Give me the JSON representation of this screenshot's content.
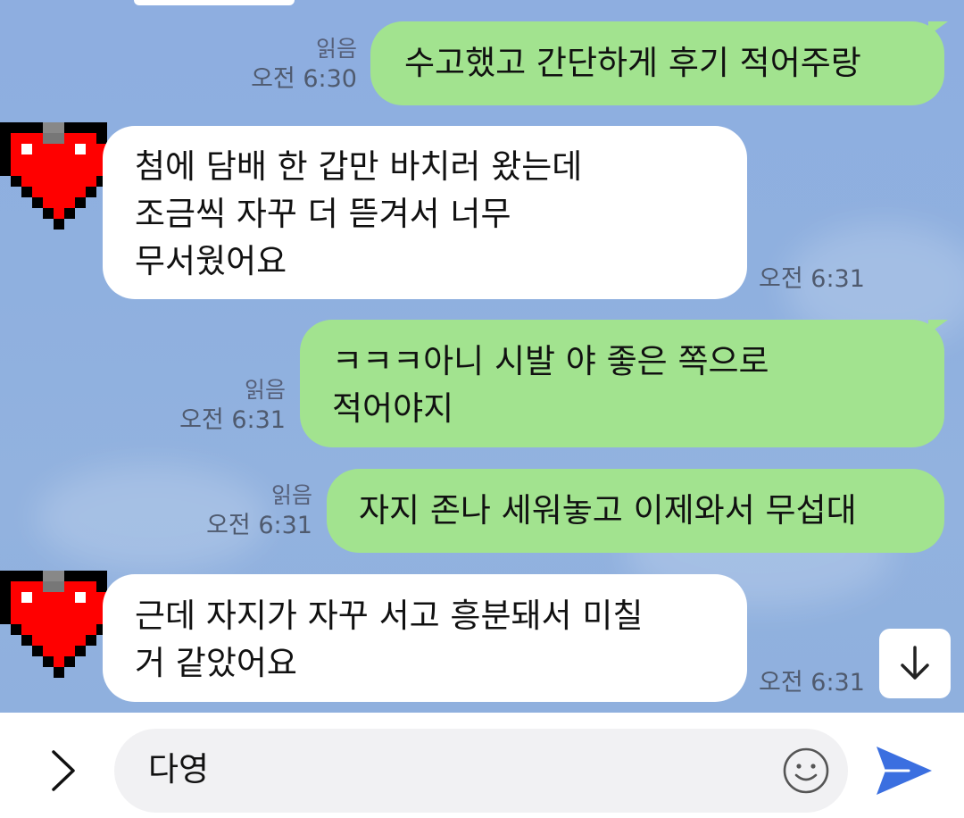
{
  "colors": {
    "chat_background": "#8eaee0",
    "outgoing_bubble": "#a2e38f",
    "incoming_bubble": "#ffffff",
    "send_accent": "#3b6fe0",
    "avatar_heart": "#ff0000"
  },
  "messages": [
    {
      "direction": "outgoing",
      "text": "수고했고 간단하게 후기 적어주랑",
      "read": "읽음",
      "time": "오전 6:30"
    },
    {
      "direction": "incoming",
      "lines": [
        "첨에 담배 한 갑만 바치러 왔는데",
        "조금씩 자꾸 더 뜯겨서 너무",
        "무서웠어요"
      ],
      "time": "오전 6:31",
      "avatar": "pixel-heart-icon"
    },
    {
      "direction": "outgoing",
      "lines": [
        "ㅋㅋㅋ아니 시발 야 좋은 쪽으로",
        "적어야지"
      ],
      "read": "읽음",
      "time": "오전 6:31"
    },
    {
      "direction": "outgoing",
      "text": "자지 존나 세워놓고 이제와서 무섭대",
      "read": "읽음",
      "time": "오전 6:31"
    },
    {
      "direction": "incoming",
      "lines": [
        "근데 자지가 자꾸 서고 흥분돼서 미칠",
        "거 같았어요"
      ],
      "time": "오전 6:31",
      "avatar": "pixel-heart-icon"
    }
  ],
  "input": {
    "value": "다영",
    "expand_icon": "chevron-right-icon",
    "emoji_icon": "smiley-icon",
    "send_icon": "send-arrow-icon"
  },
  "scroll_button": {
    "icon": "arrow-down-icon"
  }
}
